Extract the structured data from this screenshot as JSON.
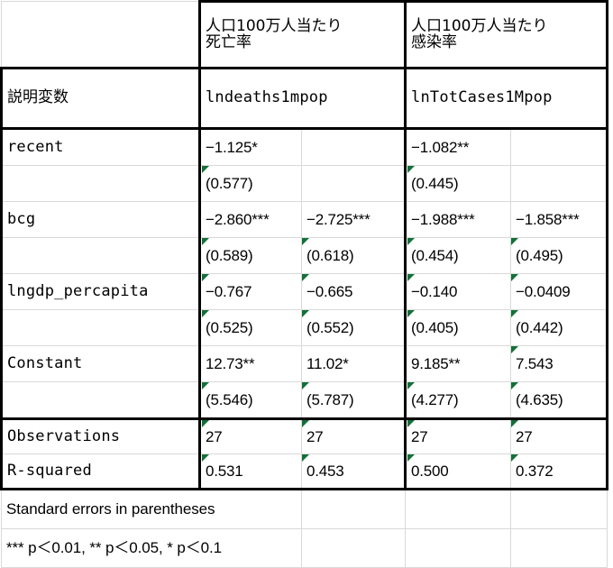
{
  "app": {
    "kind": "spreadsheet-regression-table",
    "comment_marker_color": "#127038",
    "grid_line_color": "#d9d9d9",
    "rule_color": "#000000"
  },
  "table": {
    "corner_cell": "",
    "column_groups": [
      {
        "line1": "人口100万人当たり",
        "line2": "死亡率"
      },
      {
        "line1": "人口100万人当たり",
        "line2": "感染率"
      }
    ],
    "variable_header": {
      "row_label": "説明変数",
      "dep_vars": [
        "lndeaths1mpop",
        "lnTotCases1Mpop"
      ]
    },
    "rows": [
      {
        "label": "recent",
        "coefficients": [
          "−1.125*",
          "",
          "−1.082**",
          ""
        ],
        "std_errors": [
          "(0.577)",
          "",
          "(0.445)",
          ""
        ]
      },
      {
        "label": "bcg",
        "coefficients": [
          "−2.860***",
          "−2.725***",
          "−1.988***",
          "−1.858***"
        ],
        "std_errors": [
          "(0.589)",
          "(0.618)",
          "(0.454)",
          "(0.495)"
        ]
      },
      {
        "label": "lngdp_percapita",
        "coefficients": [
          "−0.767",
          "−0.665",
          "−0.140",
          "−0.0409"
        ],
        "std_errors": [
          "(0.525)",
          "(0.552)",
          "(0.405)",
          "(0.442)"
        ]
      },
      {
        "label": "Constant",
        "coefficients": [
          "12.73**",
          "11.02*",
          "9.185**",
          "7.543"
        ],
        "std_errors": [
          "(5.546)",
          "(5.787)",
          "(4.277)",
          "(4.635)"
        ]
      }
    ],
    "statistics": [
      {
        "label": "Observations",
        "values": [
          "27",
          "27",
          "27",
          "27"
        ]
      },
      {
        "label": "R-squared",
        "values": [
          "0.531",
          "0.453",
          "0.500",
          "0.372"
        ]
      }
    ],
    "notes": [
      "Standard errors in parentheses",
      "*** p＜0.01, ** p＜0.05, * p＜0.1"
    ]
  },
  "chart_data": {
    "type": "table",
    "title": "Regression results: COVID-19 deaths and cases per million",
    "row_variables": [
      "recent",
      "bcg",
      "lngdp_percapita",
      "Constant"
    ],
    "column_models": [
      {
        "group": "人口100万人当たり死亡率",
        "dependent": "lndeaths1mpop",
        "model": 1
      },
      {
        "group": "人口100万人当たり死亡率",
        "dependent": "lndeaths1mpop",
        "model": 2
      },
      {
        "group": "人口100万人当たり感染率",
        "dependent": "lnTotCases1Mpop",
        "model": 1
      },
      {
        "group": "人口100万人当たり感染率",
        "dependent": "lnTotCases1Mpop",
        "model": 2
      }
    ],
    "coefficients": {
      "recent": [
        -1.125,
        null,
        -1.082,
        null
      ],
      "bcg": [
        -2.86,
        -2.725,
        -1.988,
        -1.858
      ],
      "lngdp_percapita": [
        -0.767,
        -0.665,
        -0.14,
        -0.0409
      ],
      "Constant": [
        12.73,
        11.02,
        9.185,
        7.543
      ]
    },
    "standard_errors": {
      "recent": [
        0.577,
        null,
        0.445,
        null
      ],
      "bcg": [
        0.589,
        0.618,
        0.454,
        0.495
      ],
      "lngdp_percapita": [
        0.525,
        0.552,
        0.405,
        0.442
      ],
      "Constant": [
        5.546,
        5.787,
        4.277,
        4.635
      ]
    },
    "significance_stars": {
      "recent": [
        "*",
        "",
        "**",
        ""
      ],
      "bcg": [
        "***",
        "***",
        "***",
        "***"
      ],
      "lngdp_percapita": [
        "",
        "",
        "",
        ""
      ],
      "Constant": [
        "**",
        "*",
        "**",
        ""
      ]
    },
    "observations": [
      27,
      27,
      27,
      27
    ],
    "r_squared": [
      0.531,
      0.453,
      0.5,
      0.372
    ],
    "significance_legend": {
      "***": "p<0.01",
      "**": "p<0.05",
      "*": "p<0.1"
    }
  }
}
